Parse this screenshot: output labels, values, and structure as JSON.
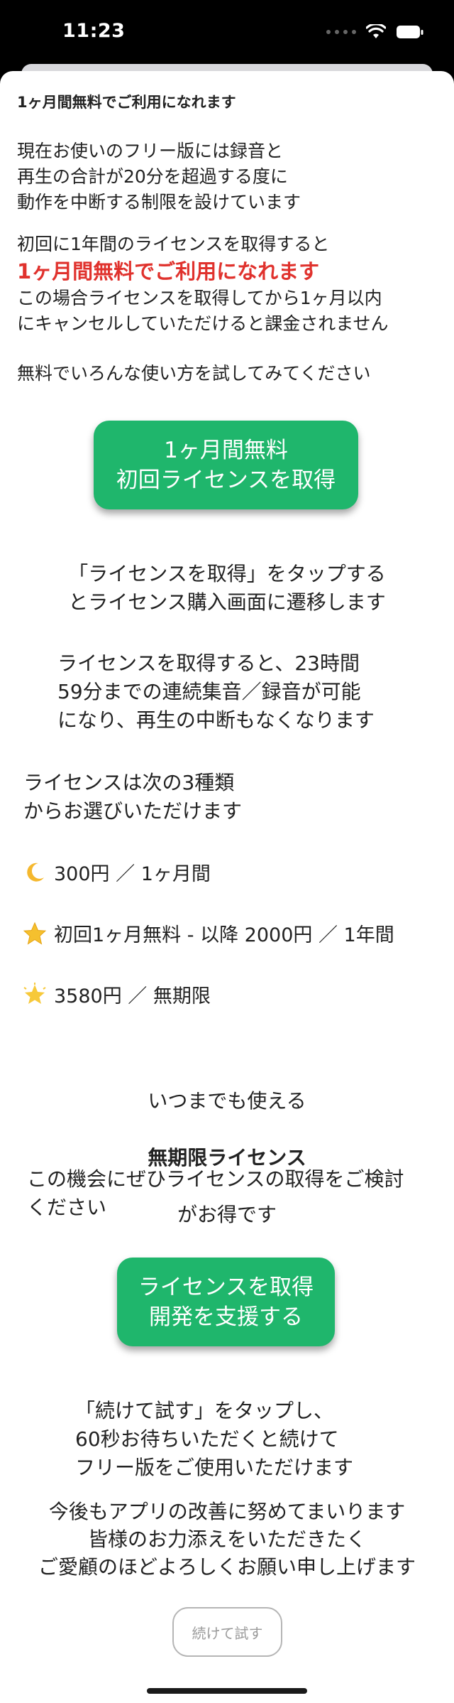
{
  "status_bar": {
    "time": "11:23"
  },
  "header": {
    "title": "1ヶ月間無料でご利用になれます"
  },
  "intro": "現在お使いのフリー版には録音と\n再生の合計が20分を超過する度に\n動作を中断する制限を設けています",
  "offer": {
    "line1": "初回に1年間のライセンスを取得すると",
    "highlight": "1ヶ月間無料でご利用になれます",
    "line3": "この場合ライセンスを取得してから1ヶ月以内\nにキャンセルしていただけると課金されません"
  },
  "try_text": "無料でいろんな使い方を試してみてください",
  "primary_button": {
    "label": "1ヶ月間無料\n初回ライセンスを取得"
  },
  "tap_info": "「ライセンスを取得」をタップする\nとライセンス購入画面に遷移します",
  "benefit": "ライセンスを取得すると、23時間\n59分までの連続集音／録音が可能\nになり、再生の中断もなくなります",
  "plans_intro": "ライセンスは次の3種類\nからお選びいただけます",
  "plans": [
    {
      "icon": "crescent-moon-icon",
      "label": "300円 ／ 1ヶ月間"
    },
    {
      "icon": "star-icon",
      "label": "初回1ヶ月無料 - 以降 2000円 ／ 1年間"
    },
    {
      "icon": "glowing-star-icon",
      "label": "3580円 ／ 無期限"
    }
  ],
  "forever": {
    "line1": "いつまでも使える",
    "line2": "無期限ライセンス",
    "line3": "がお得です"
  },
  "consider": "この機会にぜひライセンスの取得をご検討\nください",
  "support_button": {
    "label": "ライセンスを取得\n開発を支援する"
  },
  "continue_info": "「続けて試す」をタップし、\n60秒お待ちいただくと続けて\nフリー版をご使用いただけます",
  "closing": "今後もアプリの改善に努めてまいります\n皆様のお力添えをいただきたく\nご愛顧のほどよろしくお願い申し上げます",
  "continue_button": {
    "label": "続けて試す"
  },
  "colors": {
    "accent_green": "#1fb66c",
    "highlight_red": "#e0322d"
  }
}
